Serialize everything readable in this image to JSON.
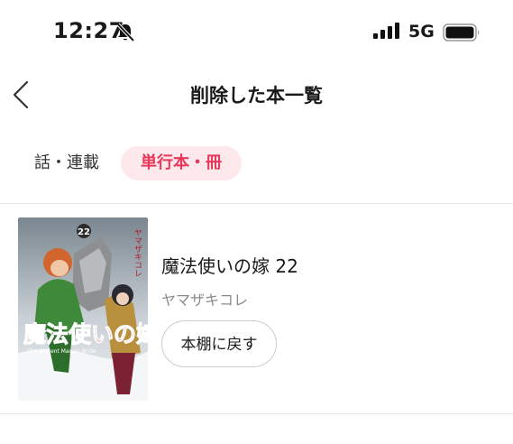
{
  "status_bar": {
    "time": "12:27",
    "network": "5G",
    "icons": [
      "bell-slash-icon",
      "signal-icon",
      "battery-icon"
    ]
  },
  "header": {
    "title": "削除した本一覧",
    "back_icon": "chevron-left-icon"
  },
  "tabs": [
    {
      "label": "話・連載",
      "selected": false
    },
    {
      "label": "単行本・冊",
      "selected": true
    }
  ],
  "books": [
    {
      "title": "魔法使いの嫁 22",
      "author": "ヤマザキコレ",
      "action_label": "本棚に戻す",
      "cover": {
        "volume": "22",
        "logo_text": "魔法使いの嫁",
        "subtitle": "The Ancient Magus' Bride",
        "author_vertical": "ヤマザキコレ"
      }
    }
  ],
  "colors": {
    "accent": "#e8385a",
    "accent_bg": "#fde8ec",
    "divider": "#e6e6e6",
    "muted_text": "#8a8a8a"
  }
}
